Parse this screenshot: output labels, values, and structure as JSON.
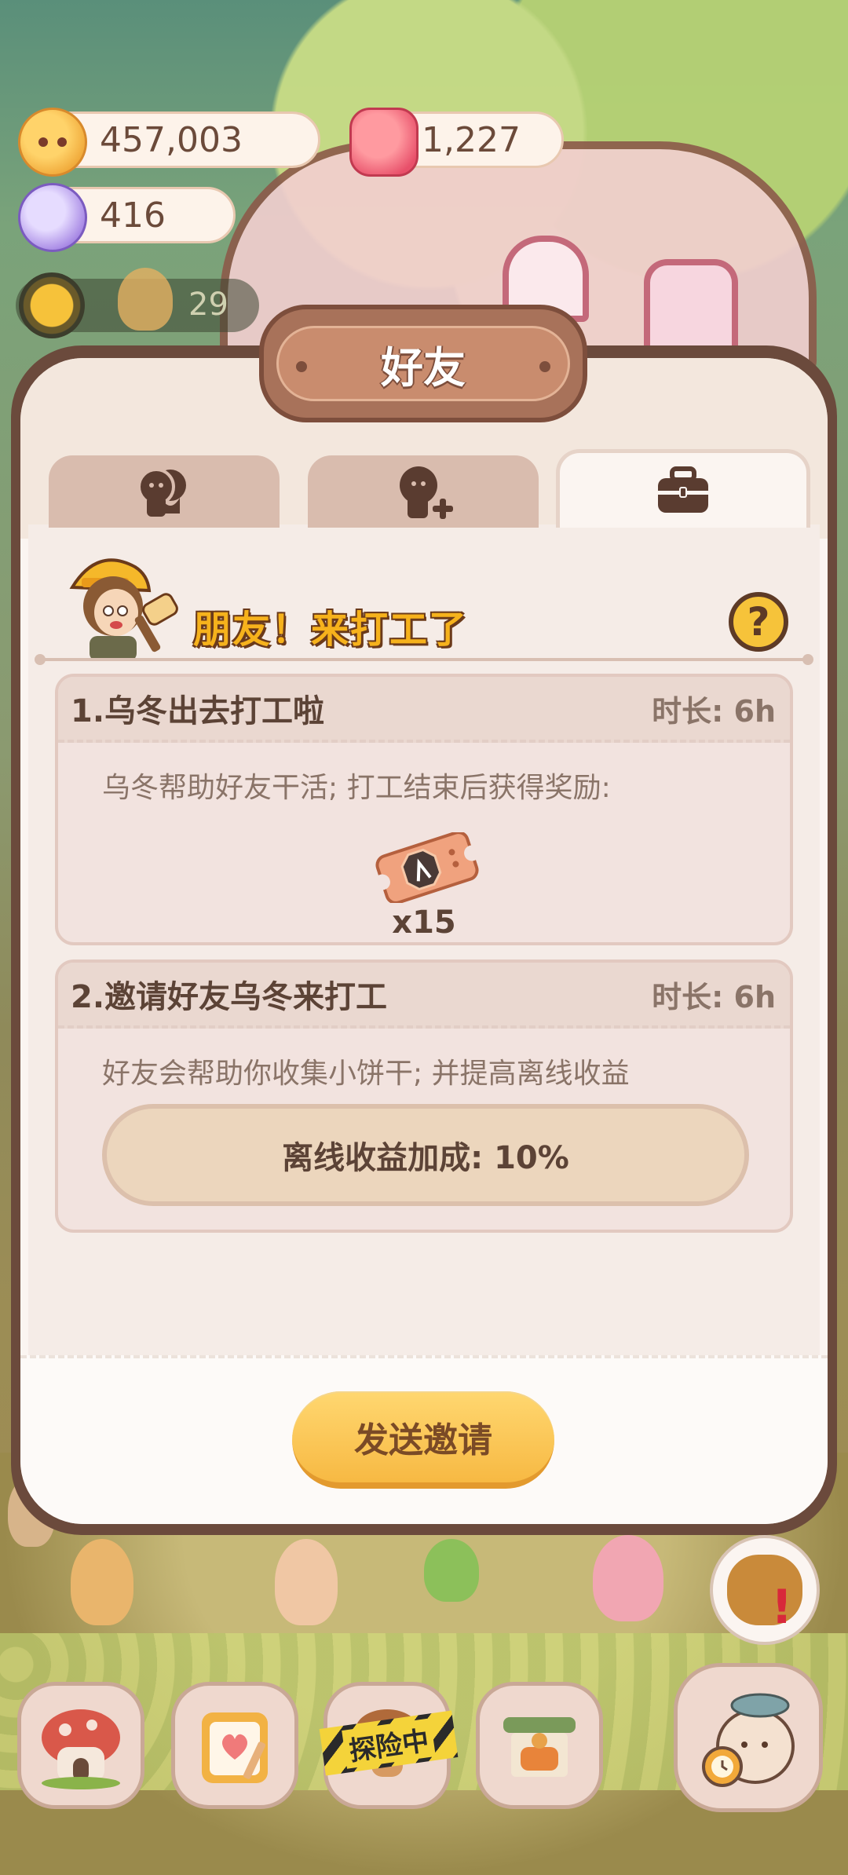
{
  "resources": {
    "cookies": "457,003",
    "gems": "1,227",
    "crystals": "416",
    "level_count": "29"
  },
  "panel": {
    "title": "好友",
    "tabs": [
      {
        "name": "friends-tab",
        "icon": "friends-icon"
      },
      {
        "name": "add-friend-tab",
        "icon": "add-friend-icon"
      },
      {
        "name": "work-tab",
        "icon": "briefcase-icon",
        "active": true
      }
    ],
    "heading": "朋友！来打工了",
    "help_label": "?"
  },
  "cards": [
    {
      "title": "1.乌冬出去打工啦",
      "duration": "时长: 6h",
      "description": "乌冬帮助好友干活; 打工结束后获得奖励:",
      "reward_icon": "ticket-icon",
      "reward_count": "x15"
    },
    {
      "title": "2.邀请好友乌冬来打工",
      "duration": "时长: 6h",
      "description": "好友会帮助你收集小饼干; 并提高离线收益",
      "bonus": "离线收益加成: 10%"
    }
  ],
  "send_button": "发送邀请",
  "bottom_nav": {
    "explore_label": "探险中",
    "items": [
      "mushroom-house-icon",
      "notebook-icon",
      "explore-icon",
      "shop-icon",
      "mascot-clock-icon"
    ]
  },
  "colors": {
    "accent": "#f7b943",
    "panel_border": "#6b4a3c",
    "heading": "#f6b21c",
    "text": "#5c4336"
  }
}
